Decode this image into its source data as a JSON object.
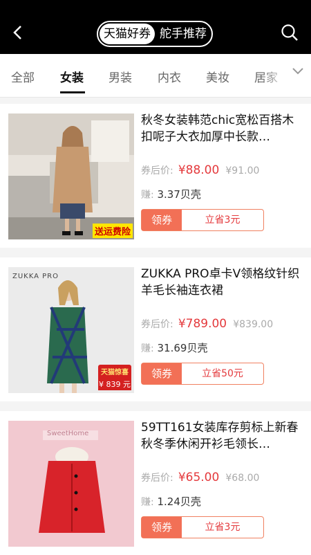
{
  "header": {
    "seg_left": "天猫好券",
    "seg_right": "舵手推荐"
  },
  "categories": [
    "全部",
    "女装",
    "男装",
    "内衣",
    "美妆",
    "居家"
  ],
  "products": [
    {
      "title": "秋冬女装韩范chic宽松百搭木扣呢子大衣加厚中长款…",
      "price_label": "券后价:",
      "price": "¥88.00",
      "orig_price": "¥91.00",
      "earn_label": "赚:",
      "earn": "3.37贝壳",
      "coupon_label": "领券",
      "save_label": "立省3元",
      "badge": "送运费险"
    },
    {
      "title": "ZUKKA PRO卓卡V领格纹针织羊毛长袖连衣裙",
      "price_label": "券后价:",
      "price": "¥789.00",
      "orig_price": "¥839.00",
      "earn_label": "赚:",
      "earn": "31.69贝壳",
      "coupon_label": "领券",
      "save_label": "立省50元",
      "brand": "ZUKKA PRO",
      "badge_top": "天猫惊喜",
      "badge_price": "¥ 839 元"
    },
    {
      "title": "59TT161女装库存剪标上新春秋冬季休闲开衫毛领长…",
      "price_label": "券后价:",
      "price": "¥65.00",
      "orig_price": "¥68.00",
      "earn_label": "赚:",
      "earn": "1.24贝壳",
      "coupon_label": "领券",
      "save_label": "立省3元",
      "sign": "SweetHome"
    }
  ],
  "colors": {
    "accent": "#e4393c",
    "coupon_bg": "#f27056",
    "topbar": "#000000"
  }
}
